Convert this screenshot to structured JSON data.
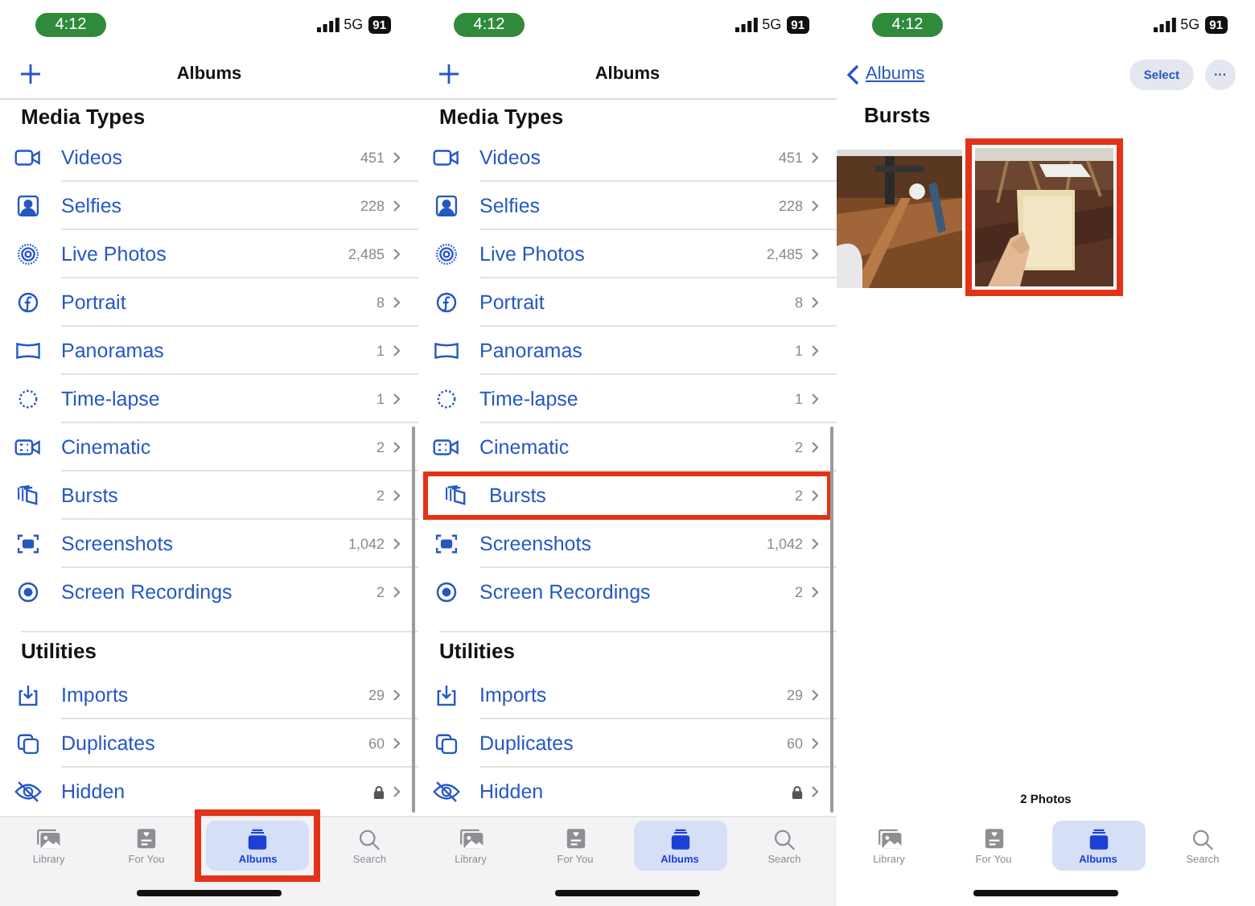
{
  "screens": [
    {
      "kind": "albums",
      "status_bar": {
        "time": "4:12",
        "network": "5G",
        "battery": "91"
      },
      "nav": {
        "title": "Albums"
      },
      "sections": [
        {
          "title": "Media Types",
          "items": [
            {
              "label": "Videos",
              "count": "451",
              "locked": false,
              "highlighted": false
            },
            {
              "label": "Selfies",
              "count": "228",
              "locked": false,
              "highlighted": false
            },
            {
              "label": "Live Photos",
              "count": "2,485",
              "locked": false,
              "highlighted": false
            },
            {
              "label": "Portrait",
              "count": "8",
              "locked": false,
              "highlighted": false
            },
            {
              "label": "Panoramas",
              "count": "1",
              "locked": false,
              "highlighted": false
            },
            {
              "label": "Time-lapse",
              "count": "1",
              "locked": false,
              "highlighted": false
            },
            {
              "label": "Cinematic",
              "count": "2",
              "locked": false,
              "highlighted": false
            },
            {
              "label": "Bursts",
              "count": "2",
              "locked": false,
              "highlighted": false
            },
            {
              "label": "Screenshots",
              "count": "1,042",
              "locked": false,
              "highlighted": false
            },
            {
              "label": "Screen Recordings",
              "count": "2",
              "locked": false,
              "highlighted": false
            }
          ]
        },
        {
          "title": "Utilities",
          "items": [
            {
              "label": "Imports",
              "count": "29",
              "locked": false,
              "highlighted": false
            },
            {
              "label": "Duplicates",
              "count": "60",
              "locked": false,
              "highlighted": false
            },
            {
              "label": "Hidden",
              "locked": true,
              "highlighted": false
            }
          ]
        }
      ],
      "tab_bar": [
        {
          "label": "Library",
          "selected": false,
          "highlighted": false
        },
        {
          "label": "For You",
          "selected": false,
          "highlighted": false
        },
        {
          "label": "Albums",
          "selected": true,
          "highlighted": true
        },
        {
          "label": "Search",
          "selected": false,
          "highlighted": false
        }
      ]
    },
    {
      "kind": "albums",
      "status_bar": {
        "time": "4:12",
        "network": "5G",
        "battery": "91"
      },
      "nav": {
        "title": "Albums"
      },
      "sections": [
        {
          "title": "Media Types",
          "items": [
            {
              "label": "Videos",
              "count": "451",
              "locked": false,
              "highlighted": false
            },
            {
              "label": "Selfies",
              "count": "228",
              "locked": false,
              "highlighted": false
            },
            {
              "label": "Live Photos",
              "count": "2,485",
              "locked": false,
              "highlighted": false
            },
            {
              "label": "Portrait",
              "count": "8",
              "locked": false,
              "highlighted": false
            },
            {
              "label": "Panoramas",
              "count": "1",
              "locked": false,
              "highlighted": false
            },
            {
              "label": "Time-lapse",
              "count": "1",
              "locked": false,
              "highlighted": false
            },
            {
              "label": "Cinematic",
              "count": "2",
              "locked": false,
              "highlighted": false
            },
            {
              "label": "Bursts",
              "count": "2",
              "locked": false,
              "highlighted": true
            },
            {
              "label": "Screenshots",
              "count": "1,042",
              "locked": false,
              "highlighted": false
            },
            {
              "label": "Screen Recordings",
              "count": "2",
              "locked": false,
              "highlighted": false
            }
          ]
        },
        {
          "title": "Utilities",
          "items": [
            {
              "label": "Imports",
              "count": "29",
              "locked": false,
              "highlighted": false
            },
            {
              "label": "Duplicates",
              "count": "60",
              "locked": false,
              "highlighted": false
            },
            {
              "label": "Hidden",
              "locked": true,
              "highlighted": false
            }
          ]
        }
      ],
      "tab_bar": [
        {
          "label": "Library",
          "selected": false,
          "highlighted": false
        },
        {
          "label": "For You",
          "selected": false,
          "highlighted": false
        },
        {
          "label": "Albums",
          "selected": true,
          "highlighted": false
        },
        {
          "label": "Search",
          "selected": false,
          "highlighted": false
        }
      ]
    },
    {
      "kind": "album",
      "status_bar": {
        "time": "4:12",
        "network": "5G",
        "battery": "91"
      },
      "nav": {
        "back": "Albums",
        "select": "Select",
        "more": "···"
      },
      "title": "Bursts",
      "photos": [
        {
          "kind": "picture",
          "highlighted": false
        },
        {
          "kind": "picture",
          "highlighted": true
        }
      ],
      "footer": "2 Photos",
      "tab_bar": [
        {
          "label": "Library",
          "selected": false,
          "highlighted": false
        },
        {
          "label": "For You",
          "selected": false,
          "highlighted": false
        },
        {
          "label": "Albums",
          "selected": true,
          "highlighted": false
        },
        {
          "label": "Search",
          "selected": false,
          "highlighted": false
        }
      ]
    }
  ]
}
